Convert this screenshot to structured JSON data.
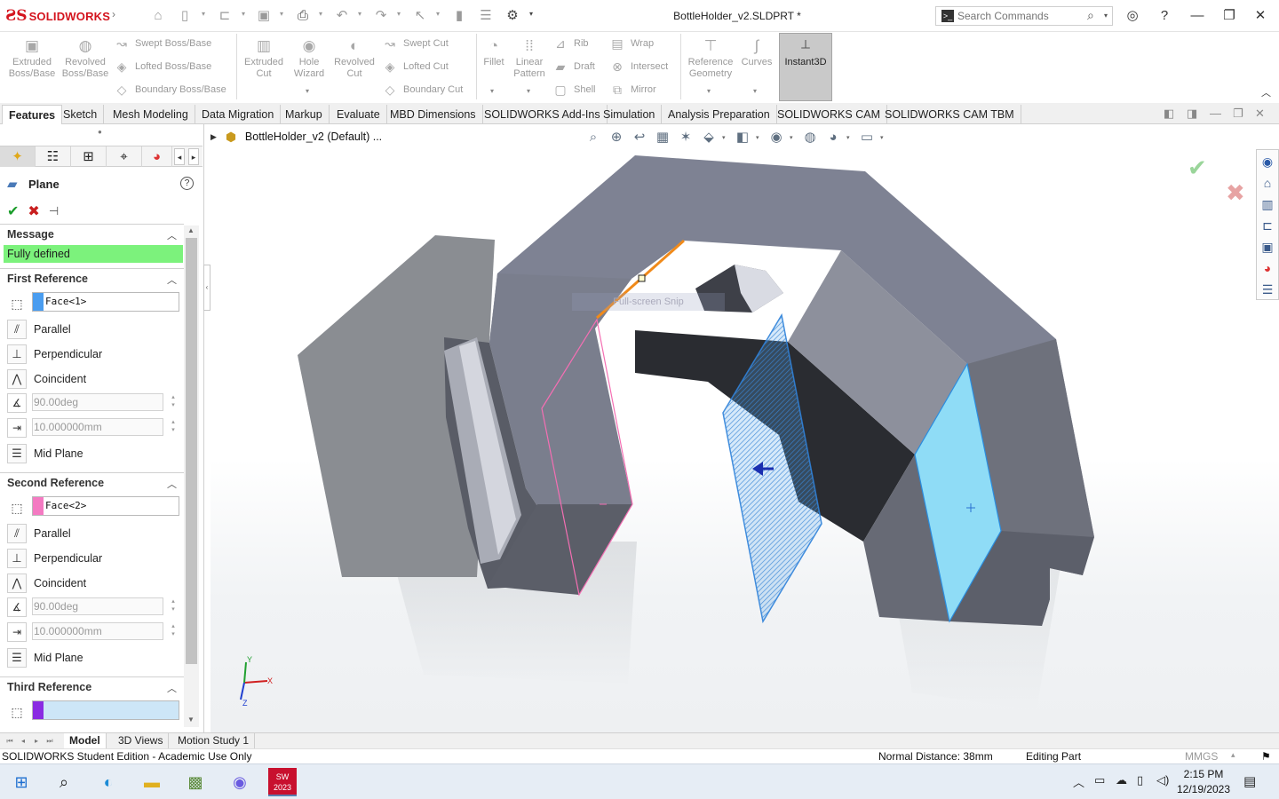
{
  "titlebar": {
    "brand": "SOLIDWORKS",
    "document_title": "BottleHolder_v2.SLDPRT *",
    "search_placeholder": "Search Commands"
  },
  "ribbon": {
    "extruded_boss": "Extruded\nBoss/Base",
    "revolved_boss": "Revolved\nBoss/Base",
    "swept_boss": "Swept Boss/Base",
    "lofted_boss": "Lofted Boss/Base",
    "boundary_boss": "Boundary Boss/Base",
    "extruded_cut": "Extruded\nCut",
    "hole_wizard": "Hole\nWizard",
    "revolved_cut": "Revolved\nCut",
    "swept_cut": "Swept Cut",
    "lofted_cut": "Lofted Cut",
    "boundary_cut": "Boundary Cut",
    "fillet": "Fillet",
    "linear_pattern": "Linear\nPattern",
    "rib": "Rib",
    "draft": "Draft",
    "shell": "Shell",
    "wrap": "Wrap",
    "intersect": "Intersect",
    "mirror": "Mirror",
    "reference_geometry": "Reference\nGeometry",
    "curves": "Curves",
    "instant3d": "Instant3D"
  },
  "tabs": [
    "Features",
    "Sketch",
    "Mesh Modeling",
    "Data Migration",
    "Markup",
    "Evaluate",
    "MBD Dimensions",
    "SOLIDWORKS Add-Ins",
    "Simulation",
    "Analysis Preparation",
    "SOLIDWORKS CAM",
    "SOLIDWORKS CAM TBM"
  ],
  "pm": {
    "title": "Plane",
    "message_header": "Message",
    "message": "Fully defined",
    "first_ref": {
      "header": "First Reference",
      "value": "Face<1>",
      "swatch": "#4a9df0",
      "parallel": "Parallel",
      "perpendicular": "Perpendicular",
      "coincident": "Coincident",
      "angle": "90.00deg",
      "distance": "10.000000mm",
      "mid_plane": "Mid Plane"
    },
    "second_ref": {
      "header": "Second Reference",
      "value": "Face<2>",
      "swatch": "#f47ac2",
      "parallel": "Parallel",
      "perpendicular": "Perpendicular",
      "coincident": "Coincident",
      "angle": "90.00deg",
      "distance": "10.000000mm",
      "mid_plane": "Mid Plane"
    },
    "third_ref": {
      "header": "Third Reference",
      "value": "",
      "swatch": "#8a2be2"
    }
  },
  "viewport": {
    "tree_root": "BottleHolder_v2 (Default) ...",
    "snip_text": "Full-screen Snip",
    "triad": {
      "x": "X",
      "y": "Y",
      "z": "Z"
    }
  },
  "bottom_tabs": [
    "Model",
    "3D Views",
    "Motion Study 1"
  ],
  "status": {
    "edition": "SOLIDWORKS Student Edition - Academic Use Only",
    "normal_distance": "Normal Distance: 38mm",
    "mode": "Editing Part",
    "units": "MMGS"
  },
  "taskbar": {
    "time": "2:15 PM",
    "date": "12/19/2023",
    "sw_badge": "2023"
  }
}
